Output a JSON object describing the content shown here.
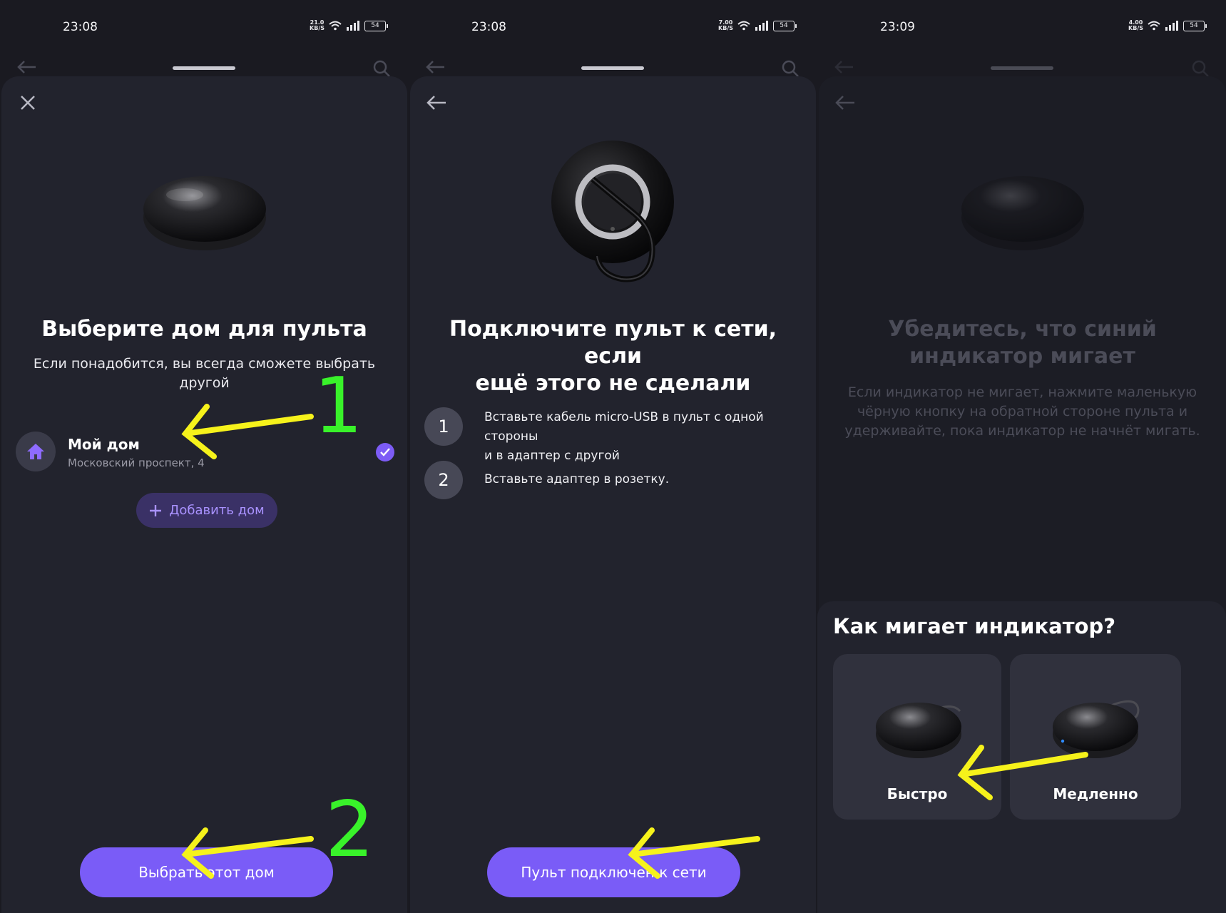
{
  "panels": [
    {
      "status": {
        "time": "23:08",
        "speed_value": "21.0",
        "speed_unit": "KB/S",
        "battery": "54"
      },
      "title": "Выберите дом для пульта",
      "subtitle": "Если понадобится, вы всегда сможете выбрать другой",
      "home": {
        "name": "Мой дом",
        "address": "Московский проспект, 4",
        "selected": true
      },
      "add_home_label": "Добавить дом",
      "primary_button": "Выбрать этот дом",
      "top_icon": "close-icon"
    },
    {
      "status": {
        "time": "23:08",
        "speed_value": "7.00",
        "speed_unit": "KB/S",
        "battery": "54"
      },
      "title_line1": "Подключите пульт к сети, если",
      "title_line2": "ещё этого не сделали",
      "steps": [
        {
          "num": "1",
          "line1": "Вставьте кабель micro-USB в пульт с одной стороны",
          "line2": "и в адаптер с другой"
        },
        {
          "num": "2",
          "line1": "Вставьте адаптер в розетку.",
          "line2": ""
        }
      ],
      "primary_button": "Пульт подключен к сети",
      "top_icon": "back-arrow-icon"
    },
    {
      "status": {
        "time": "23:09",
        "speed_value": "4.00",
        "speed_unit": "KB/S",
        "battery": "54"
      },
      "title_line1": "Убедитесь, что синий",
      "title_line2": "индикатор мигает",
      "sub_line1": "Если индикатор не мигает, нажмите маленькую",
      "sub_line2": "чёрную кнопку на обратной стороне пульта и",
      "sub_line3": "удерживайте, пока индикатор не начнёт мигать.",
      "sheet_title": "Как мигает индикатор?",
      "options": [
        {
          "label": "Быстро"
        },
        {
          "label": "Медленно"
        }
      ],
      "top_icon": "back-arrow-icon"
    }
  ],
  "annotations": {
    "label_1": "1",
    "label_2": "2",
    "arrow_color": "#f6f21b",
    "number_color": "#39f22a"
  },
  "colors": {
    "background": "#1a1a21",
    "sheet": "#22232d",
    "accent": "#7a5cf7",
    "accent_soft": "#3a3166"
  }
}
